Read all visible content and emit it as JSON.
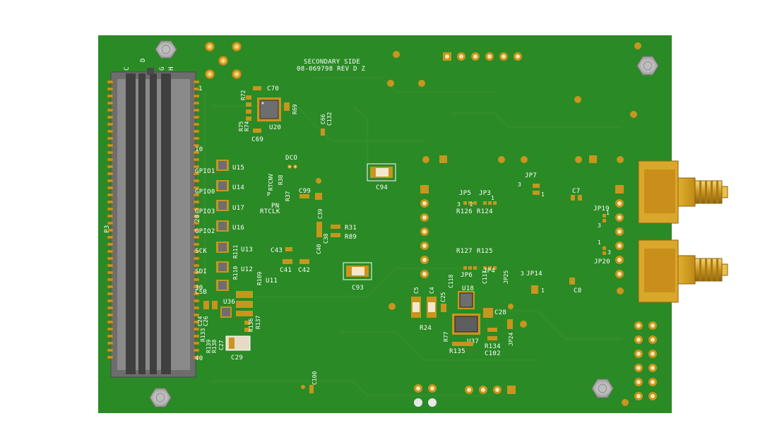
{
  "board": {
    "title_line1": "SECONDARY SIDE",
    "title_line2": "08-069798 REV D Z",
    "connector_ref": "P3",
    "connector_top_labels": [
      "C",
      "D",
      "G",
      "H"
    ],
    "connector_pin_labels": [
      "1",
      "10",
      "20",
      "30",
      "40"
    ]
  },
  "signal_labels": [
    "GPIO1",
    "GPIO0",
    "GPIO3",
    "GPIO2",
    "SCK",
    "SDI",
    "CSB",
    "DCO",
    "RTCNV",
    "RTCLK",
    "PN",
    "P"
  ],
  "refdes": {
    "u20": "U20",
    "c70": "C70",
    "r72": "R72",
    "r69": "R69",
    "r75": "R75",
    "r74": "R74",
    "c69": "C69",
    "c66": "C66",
    "c132": "C132",
    "u15": "U15",
    "u14": "U14",
    "u17": "U17",
    "u16": "U16",
    "u13": "U13",
    "u12": "U12",
    "u11": "U11",
    "u36": "U36",
    "r111": "R111",
    "r110": "R110",
    "r109": "R109",
    "r38": "R38",
    "r37": "R37",
    "c99": "C99",
    "c39": "C39",
    "r31": "R31",
    "r89": "R89",
    "c40": "C40",
    "c38": "C38",
    "c43": "C43",
    "c41": "C41",
    "c42": "C42",
    "c94": "C94",
    "c93": "C93",
    "c24": "C24",
    "c26": "C26",
    "r133": "R133",
    "r136": "R136",
    "r137": "R137",
    "r139": "R139",
    "r138": "R138",
    "c27": "C27",
    "c29": "C29",
    "c100": "C100",
    "jp5": "JP5",
    "jp3": "JP3",
    "r126": "R126",
    "r124": "R124",
    "jp7": "JP7",
    "c7": "C7",
    "jp19": "JP19",
    "jp20": "JP20",
    "r127": "R127",
    "r125": "R125",
    "jp6": "JP6",
    "jp4": "JP4",
    "c118": "C118",
    "c117": "C117",
    "jp25": "JP25",
    "jp14": "JP14",
    "c8": "C8",
    "c5": "C5",
    "c4": "C4",
    "c25": "C25",
    "u18": "U18",
    "c28": "C28",
    "r24": "R24",
    "r77": "R77",
    "u37": "U37",
    "r134": "R134",
    "c102": "C102",
    "jp24": "JP24",
    "r135": "R135"
  },
  "pin_numbers": {
    "one": "1",
    "two": "2",
    "three": "3"
  },
  "colors": {
    "pcb_green": "#2a8a25",
    "pcb_dark": "#1f6f1b",
    "copper_pad": "#c8951e",
    "gold": "#d4a12a",
    "silkscreen": "#ffffff",
    "connector_gray": "#7a7a7a"
  }
}
